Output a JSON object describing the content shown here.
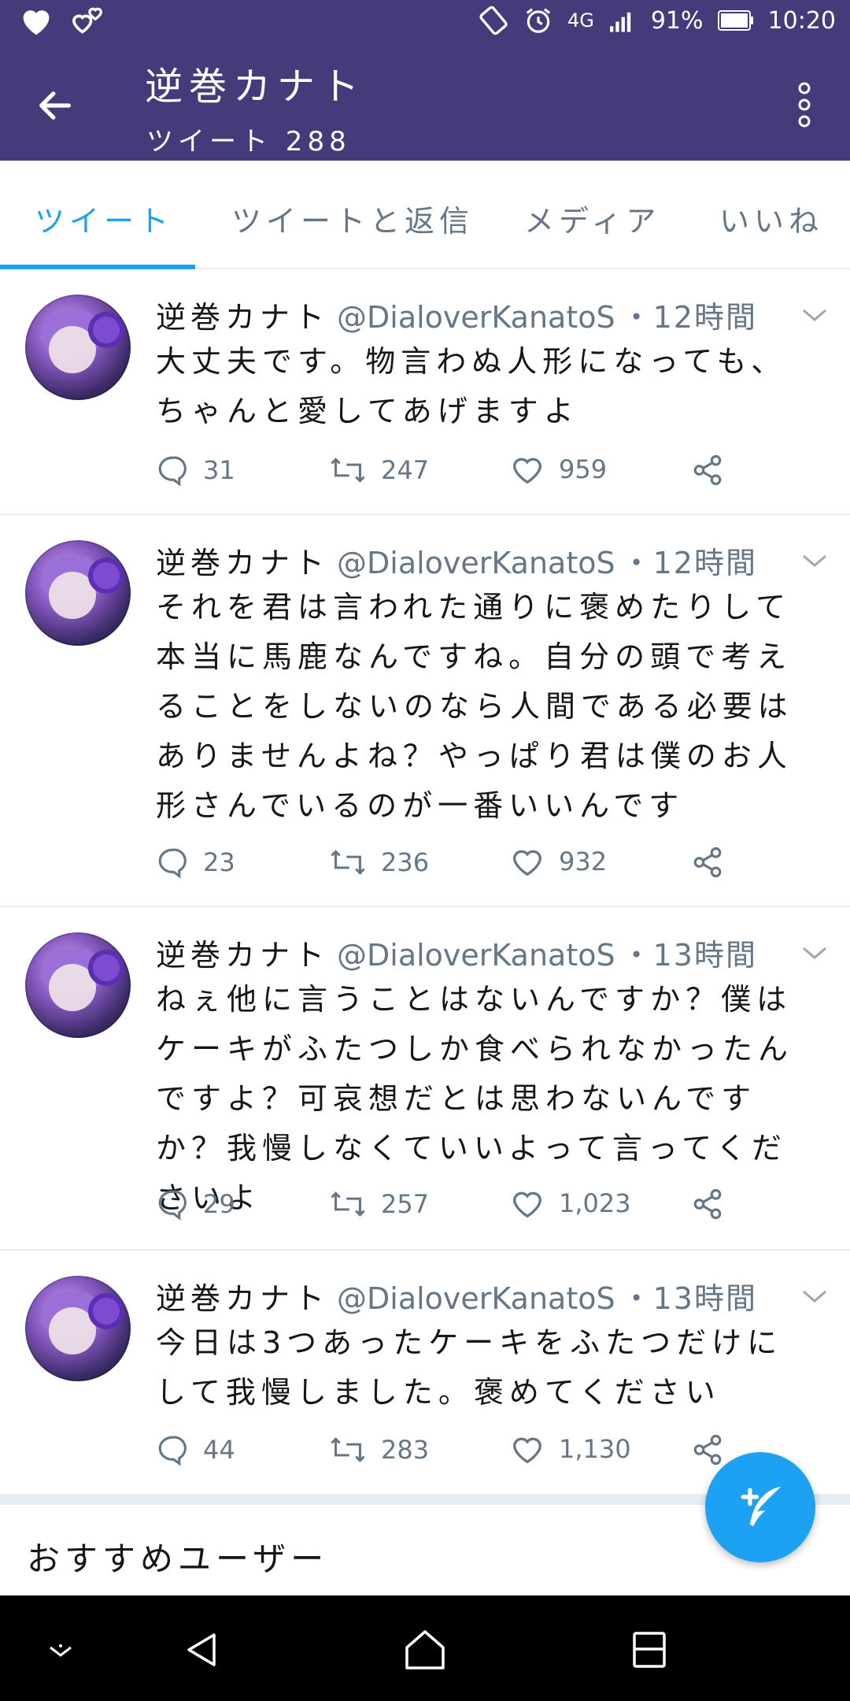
{
  "status_bar": {
    "network": "4G",
    "battery": "91%",
    "clock": "10:20"
  },
  "app_bar": {
    "title": "逆巻カナト",
    "subtitle": "ツイート 288"
  },
  "tabs": [
    {
      "label": "ツイート",
      "active": true
    },
    {
      "label": "ツイートと返信",
      "active": false
    },
    {
      "label": "メディア",
      "active": false
    },
    {
      "label": "いいね",
      "active": false
    }
  ],
  "tweets": [
    {
      "name": "逆巻カナト",
      "handle": "@DialoverKanatoS",
      "time": "・12時間",
      "text": "大丈夫です。物言わぬ人形になっても、ちゃんと愛してあげますよ",
      "replies": "31",
      "retweets": "247",
      "likes": "959"
    },
    {
      "name": "逆巻カナト",
      "handle": "@DialoverKanatoS",
      "time": "・12時間",
      "text": "それを君は言われた通りに褒めたりして本当に馬鹿なんですね。自分の頭で考えることをしないのなら人間である必要はありませんよね？やっぱり君は僕のお人形さんでいるのが一番いいんです",
      "replies": "23",
      "retweets": "236",
      "likes": "932"
    },
    {
      "name": "逆巻カナト",
      "handle": "@DialoverKanatoS",
      "time": "・13時間",
      "text": "ねぇ他に言うことはないんですか？僕はケーキがふたつしか食べられなかったんですよ？可哀想だとは思わないんですか？我慢しなくていいよって言ってくださいよ",
      "replies": "29",
      "retweets": "257",
      "likes": "1,023"
    },
    {
      "name": "逆巻カナト",
      "handle": "@DialoverKanatoS",
      "time": "・13時間",
      "text": "今日は3つあったケーキをふたつだけにして我慢しました。褒めてください",
      "replies": "44",
      "retweets": "283",
      "likes": "1,130"
    }
  ],
  "recommended_users": {
    "heading": "おすすめユーザー"
  },
  "colors": {
    "app_bar": "#443c7a",
    "accent": "#1da1f2",
    "secondary_text": "#657786"
  }
}
